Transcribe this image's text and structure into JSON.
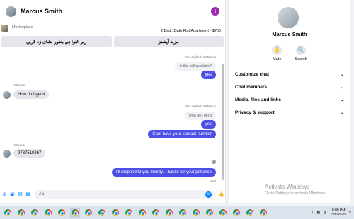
{
  "header": {
    "name": "Marcus Smith",
    "info_icon": "i"
  },
  "listing": {
    "label": "Marketplace",
    "title": "2 Bed 1Bath Flat/Apartment - $750"
  },
  "quick_replies": [
    "زیر التوا ہے بطور نشان زد کریں",
    "مزید آپشنز"
  ],
  "messages": {
    "replied_1": "You replied to Marcus",
    "quoted_1": "Is this still available?",
    "out_1": "yes",
    "sender_1": "Marcus",
    "in_1": "How do I get it",
    "replied_2": "You replied to Marcus",
    "quoted_2": "How do I get it",
    "out_2": "yes",
    "out_3": "CanI have your contact number",
    "sender_2": "Marcus",
    "in_2": "9787510267",
    "out_4": "I'll respond to you shortly. Thanks for your patience",
    "status": "Sent"
  },
  "composer": {
    "placeholder": "Aa"
  },
  "profile": {
    "name": "Marcus Smith",
    "actions": [
      "Mute",
      "Search"
    ],
    "sections": [
      "Customize chat",
      "Chat members",
      "Media, files and links",
      "Privacy & support"
    ]
  },
  "watermark": {
    "line1": "Activate Windows",
    "line2": "Go to Settings to activate Windows."
  },
  "taskbar": {
    "time": "8:09 PM",
    "date": "5/8/2025"
  },
  "colors": {
    "accent": "#4c4ee6",
    "messenger_blue": "#0084ff",
    "info": "#9c27b0"
  }
}
